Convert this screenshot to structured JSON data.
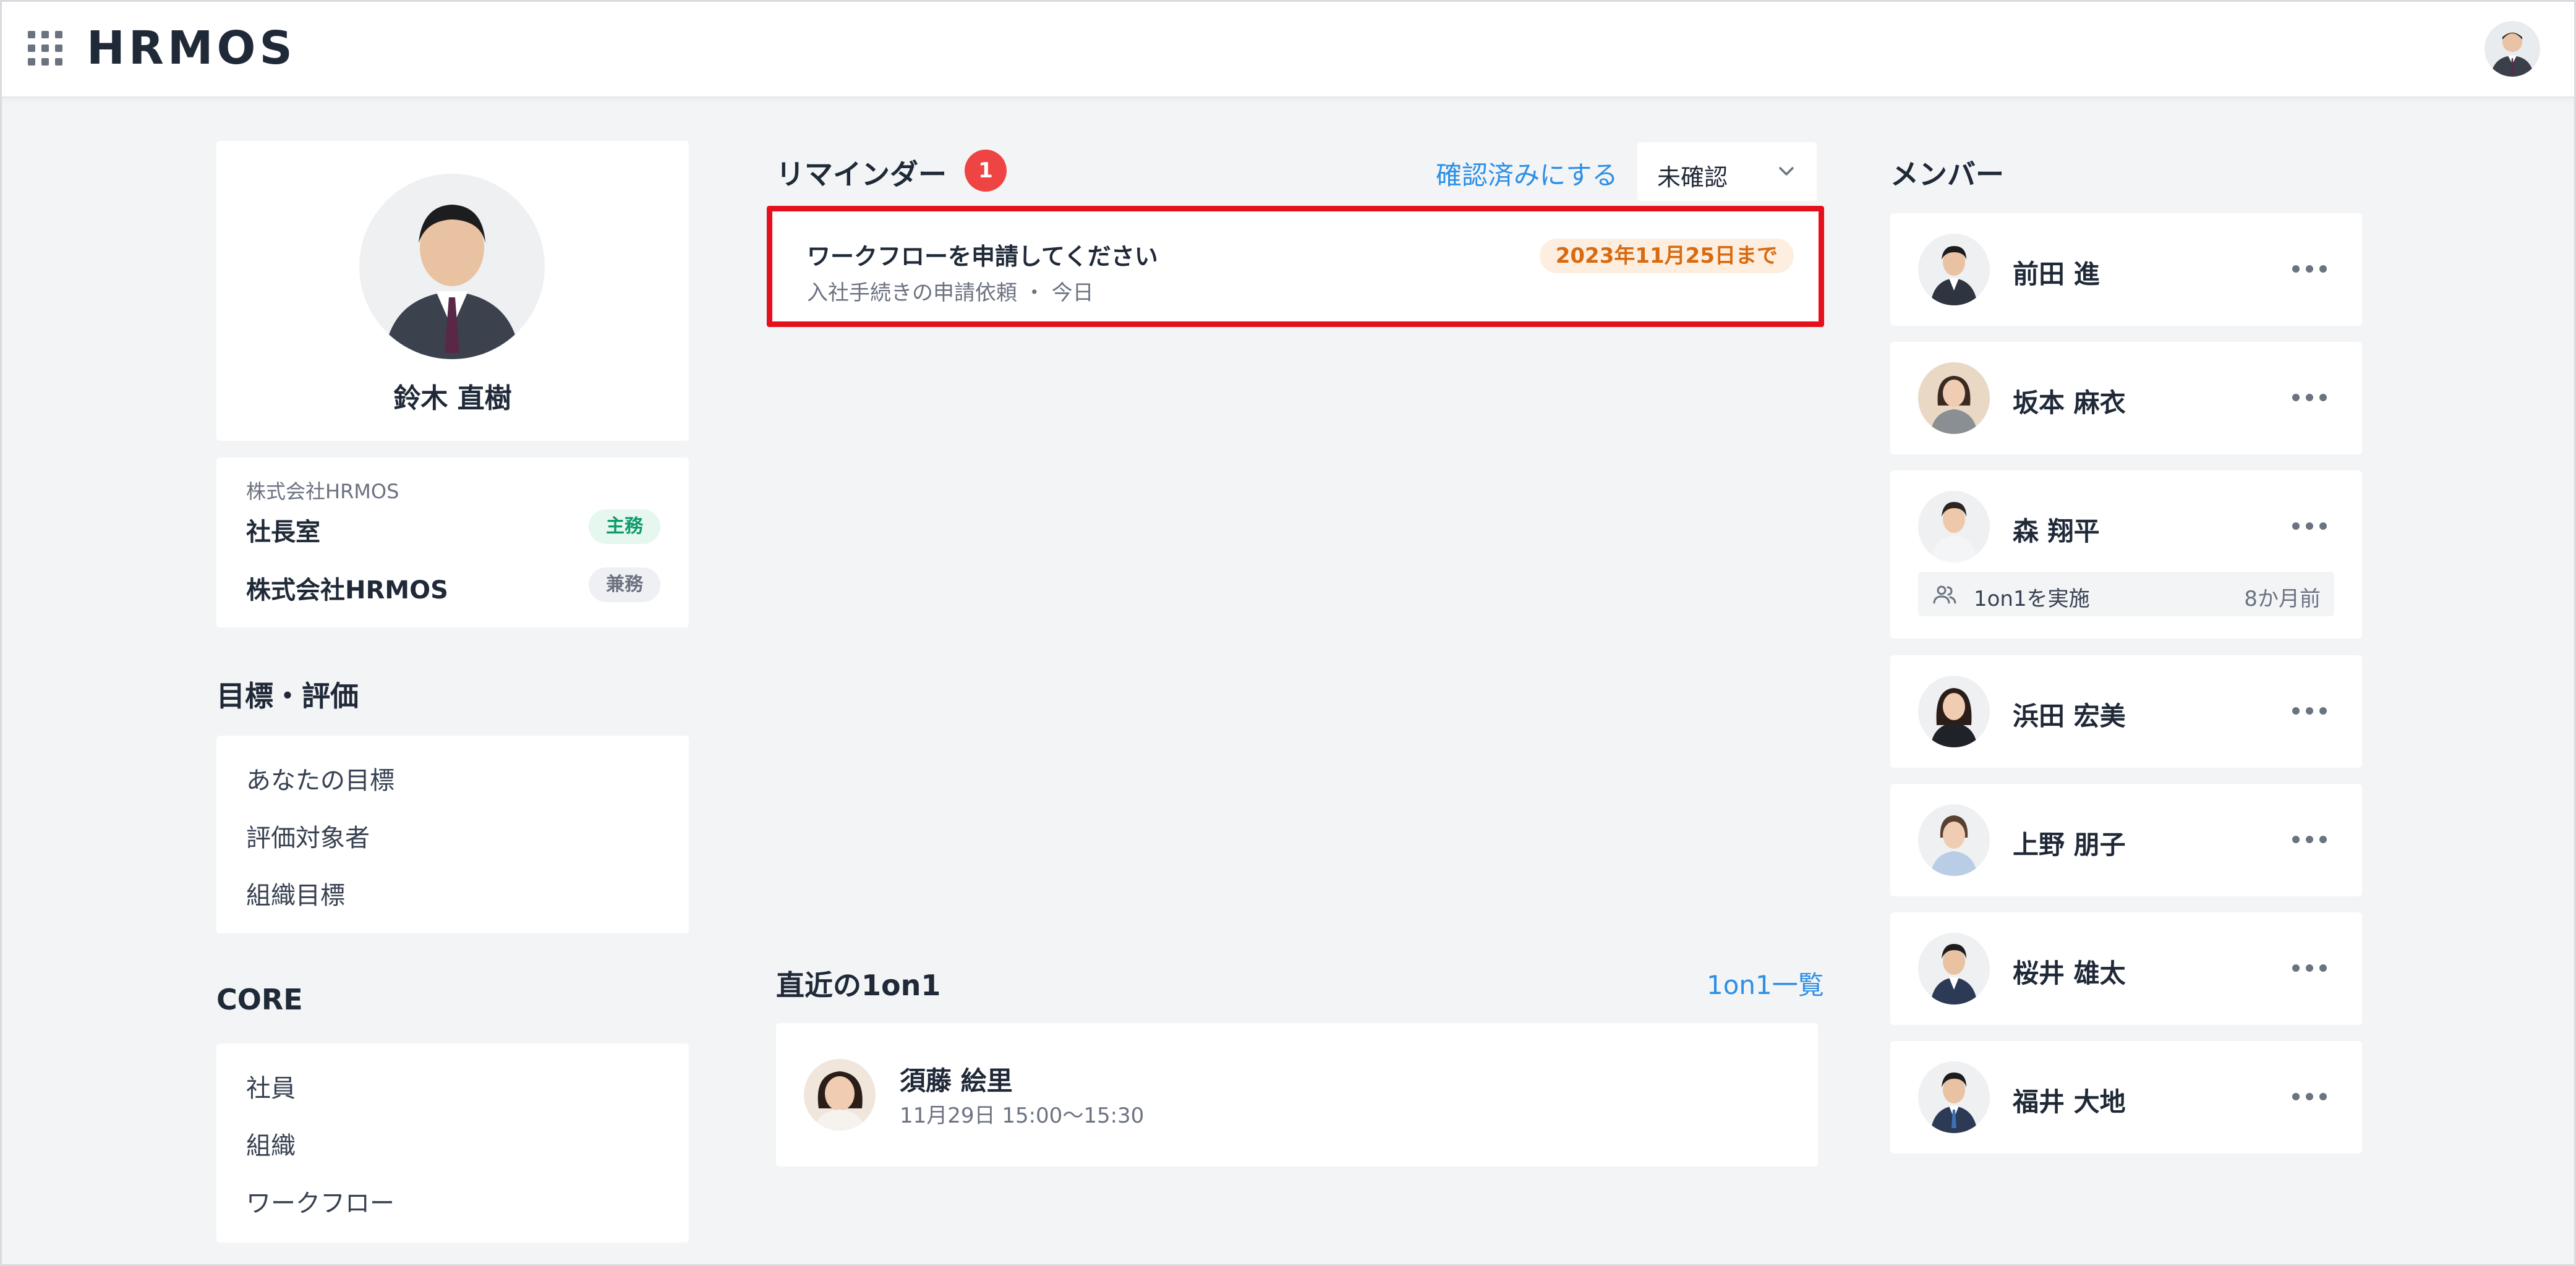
{
  "header": {
    "logo": "HRMOS",
    "apps_icon": "grid-icon",
    "user_avatar": "user-avatar"
  },
  "profile": {
    "name": "鈴木 直樹",
    "company": "株式会社HRMOS",
    "affiliations": [
      {
        "name": "社長室",
        "badge": "主務"
      },
      {
        "name": "株式会社HRMOS",
        "badge": "兼務"
      }
    ]
  },
  "goals": {
    "title": "目標・評価",
    "items": [
      "あなたの目標",
      "評価対象者",
      "組織目標"
    ]
  },
  "core": {
    "title": "CORE",
    "items": [
      "社員",
      "組織",
      "ワークフロー"
    ]
  },
  "reminders": {
    "title": "リマインダー",
    "count": "1",
    "mark_read_label": "確認済みにする",
    "filter_value": "未確認",
    "items": [
      {
        "title": "ワークフローを申請してください",
        "sub": "入社手続きの申請依頼 ・ 今日",
        "due": "2023年11月25日まで"
      }
    ]
  },
  "oneonone": {
    "title": "直近の1on1",
    "list_link": "1on1一覧",
    "items": [
      {
        "name": "須藤 絵里",
        "time": "11月29日 15:00〜15:30"
      }
    ]
  },
  "members": {
    "title": "メンバー",
    "items": [
      {
        "name": "前田 進"
      },
      {
        "name": "坂本 麻衣"
      },
      {
        "name": "森 翔平",
        "activity": "1on1を実施",
        "activity_time": "8か月前"
      },
      {
        "name": "浜田 宏美"
      },
      {
        "name": "上野 朋子"
      },
      {
        "name": "桜井 雄太"
      },
      {
        "name": "福井 大地"
      }
    ]
  },
  "colors": {
    "accent_blue": "#2d8fe6",
    "alert_red": "#ef4444",
    "highlight_border": "#e4101b",
    "badge_main_green": "#0f9a6b",
    "due_orange": "#d96a0f"
  }
}
